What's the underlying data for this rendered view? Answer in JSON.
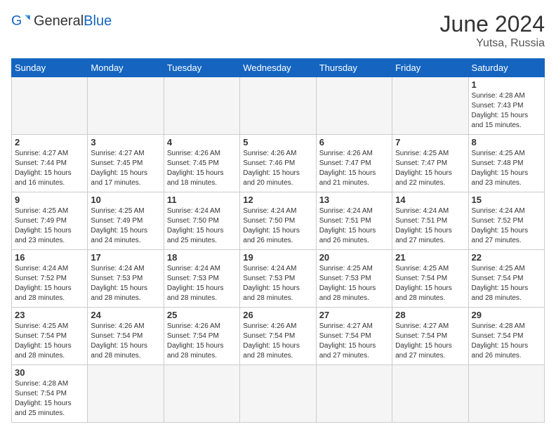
{
  "logo": {
    "text_general": "General",
    "text_blue": "Blue"
  },
  "title": "June 2024",
  "location": "Yutsa, Russia",
  "days_of_week": [
    "Sunday",
    "Monday",
    "Tuesday",
    "Wednesday",
    "Thursday",
    "Friday",
    "Saturday"
  ],
  "weeks": [
    [
      {
        "day": "",
        "info": ""
      },
      {
        "day": "",
        "info": ""
      },
      {
        "day": "",
        "info": ""
      },
      {
        "day": "",
        "info": ""
      },
      {
        "day": "",
        "info": ""
      },
      {
        "day": "",
        "info": ""
      },
      {
        "day": "1",
        "info": "Sunrise: 4:28 AM\nSunset: 7:43 PM\nDaylight: 15 hours\nand 15 minutes."
      }
    ],
    [
      {
        "day": "2",
        "info": "Sunrise: 4:27 AM\nSunset: 7:44 PM\nDaylight: 15 hours\nand 16 minutes."
      },
      {
        "day": "3",
        "info": "Sunrise: 4:27 AM\nSunset: 7:45 PM\nDaylight: 15 hours\nand 17 minutes."
      },
      {
        "day": "4",
        "info": "Sunrise: 4:26 AM\nSunset: 7:45 PM\nDaylight: 15 hours\nand 18 minutes."
      },
      {
        "day": "5",
        "info": "Sunrise: 4:26 AM\nSunset: 7:46 PM\nDaylight: 15 hours\nand 20 minutes."
      },
      {
        "day": "6",
        "info": "Sunrise: 4:26 AM\nSunset: 7:47 PM\nDaylight: 15 hours\nand 21 minutes."
      },
      {
        "day": "7",
        "info": "Sunrise: 4:25 AM\nSunset: 7:47 PM\nDaylight: 15 hours\nand 22 minutes."
      },
      {
        "day": "8",
        "info": "Sunrise: 4:25 AM\nSunset: 7:48 PM\nDaylight: 15 hours\nand 23 minutes."
      }
    ],
    [
      {
        "day": "9",
        "info": "Sunrise: 4:25 AM\nSunset: 7:49 PM\nDaylight: 15 hours\nand 23 minutes."
      },
      {
        "day": "10",
        "info": "Sunrise: 4:25 AM\nSunset: 7:49 PM\nDaylight: 15 hours\nand 24 minutes."
      },
      {
        "day": "11",
        "info": "Sunrise: 4:24 AM\nSunset: 7:50 PM\nDaylight: 15 hours\nand 25 minutes."
      },
      {
        "day": "12",
        "info": "Sunrise: 4:24 AM\nSunset: 7:50 PM\nDaylight: 15 hours\nand 26 minutes."
      },
      {
        "day": "13",
        "info": "Sunrise: 4:24 AM\nSunset: 7:51 PM\nDaylight: 15 hours\nand 26 minutes."
      },
      {
        "day": "14",
        "info": "Sunrise: 4:24 AM\nSunset: 7:51 PM\nDaylight: 15 hours\nand 27 minutes."
      },
      {
        "day": "15",
        "info": "Sunrise: 4:24 AM\nSunset: 7:52 PM\nDaylight: 15 hours\nand 27 minutes."
      }
    ],
    [
      {
        "day": "16",
        "info": "Sunrise: 4:24 AM\nSunset: 7:52 PM\nDaylight: 15 hours\nand 28 minutes."
      },
      {
        "day": "17",
        "info": "Sunrise: 4:24 AM\nSunset: 7:53 PM\nDaylight: 15 hours\nand 28 minutes."
      },
      {
        "day": "18",
        "info": "Sunrise: 4:24 AM\nSunset: 7:53 PM\nDaylight: 15 hours\nand 28 minutes."
      },
      {
        "day": "19",
        "info": "Sunrise: 4:24 AM\nSunset: 7:53 PM\nDaylight: 15 hours\nand 28 minutes."
      },
      {
        "day": "20",
        "info": "Sunrise: 4:25 AM\nSunset: 7:53 PM\nDaylight: 15 hours\nand 28 minutes."
      },
      {
        "day": "21",
        "info": "Sunrise: 4:25 AM\nSunset: 7:54 PM\nDaylight: 15 hours\nand 28 minutes."
      },
      {
        "day": "22",
        "info": "Sunrise: 4:25 AM\nSunset: 7:54 PM\nDaylight: 15 hours\nand 28 minutes."
      }
    ],
    [
      {
        "day": "23",
        "info": "Sunrise: 4:25 AM\nSunset: 7:54 PM\nDaylight: 15 hours\nand 28 minutes."
      },
      {
        "day": "24",
        "info": "Sunrise: 4:26 AM\nSunset: 7:54 PM\nDaylight: 15 hours\nand 28 minutes."
      },
      {
        "day": "25",
        "info": "Sunrise: 4:26 AM\nSunset: 7:54 PM\nDaylight: 15 hours\nand 28 minutes."
      },
      {
        "day": "26",
        "info": "Sunrise: 4:26 AM\nSunset: 7:54 PM\nDaylight: 15 hours\nand 28 minutes."
      },
      {
        "day": "27",
        "info": "Sunrise: 4:27 AM\nSunset: 7:54 PM\nDaylight: 15 hours\nand 27 minutes."
      },
      {
        "day": "28",
        "info": "Sunrise: 4:27 AM\nSunset: 7:54 PM\nDaylight: 15 hours\nand 27 minutes."
      },
      {
        "day": "29",
        "info": "Sunrise: 4:28 AM\nSunset: 7:54 PM\nDaylight: 15 hours\nand 26 minutes."
      }
    ],
    [
      {
        "day": "30",
        "info": "Sunrise: 4:28 AM\nSunset: 7:54 PM\nDaylight: 15 hours\nand 25 minutes."
      },
      {
        "day": "",
        "info": ""
      },
      {
        "day": "",
        "info": ""
      },
      {
        "day": "",
        "info": ""
      },
      {
        "day": "",
        "info": ""
      },
      {
        "day": "",
        "info": ""
      },
      {
        "day": "",
        "info": ""
      }
    ]
  ]
}
